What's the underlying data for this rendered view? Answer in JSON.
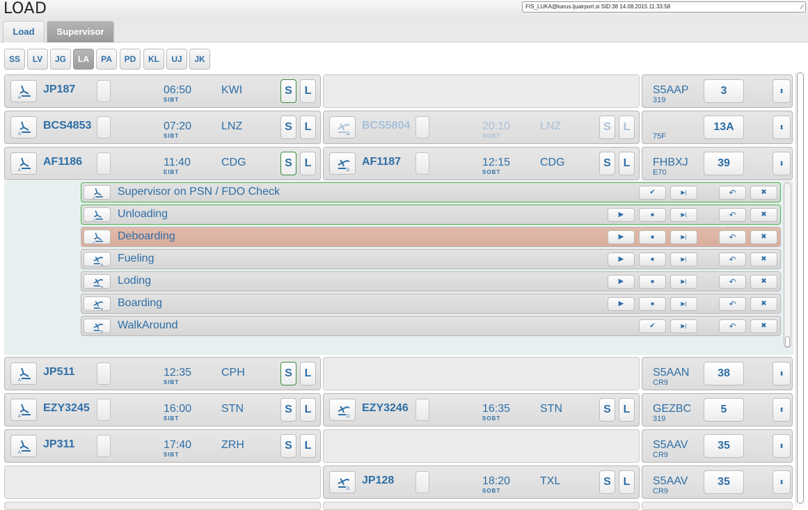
{
  "app": {
    "title": "LOAD",
    "session": "FIS_LUKA@karus.ljuairport.si SID:38 14.08.2015 11:33:58"
  },
  "tabs": [
    {
      "label": "Load",
      "active": false
    },
    {
      "label": "Supervisor",
      "active": true
    }
  ],
  "filters": [
    {
      "label": "SS",
      "active": false
    },
    {
      "label": "LV",
      "active": false
    },
    {
      "label": "JG",
      "active": false
    },
    {
      "label": "LA",
      "active": true
    },
    {
      "label": "PA",
      "active": false
    },
    {
      "label": "PD",
      "active": false
    },
    {
      "label": "KL",
      "active": false
    },
    {
      "label": "UJ",
      "active": false
    },
    {
      "label": "JK",
      "active": false
    }
  ],
  "s_label": "S",
  "l_label": "L",
  "rows": [
    {
      "arr": {
        "flight": "JP187",
        "time": "06:50",
        "time_label": "SIBT",
        "dest": "KWI",
        "s_green": true
      },
      "dep": null,
      "ac": {
        "reg": "S5AAP",
        "type": "319",
        "stand": "3"
      }
    },
    {
      "arr": {
        "flight": "BCS4853",
        "time": "07:20",
        "time_label": "SIBT",
        "dest": "LNZ",
        "s_green": false
      },
      "dep": {
        "flight": "BCS5804",
        "time": "20:10",
        "time_label": "SOBT",
        "dest": "LNZ",
        "faded": true
      },
      "ac": {
        "reg": "",
        "type": "75F",
        "stand": "13A"
      }
    },
    {
      "arr": {
        "flight": "AF1186",
        "time": "11:40",
        "time_label": "EIBT",
        "dest": "CDG",
        "s_green": true
      },
      "dep": {
        "flight": "AF1187",
        "time": "12:15",
        "time_label": "SOBT",
        "dest": "CDG",
        "faded": false
      },
      "ac": {
        "reg": "FHBXJ",
        "type": "E70",
        "stand": "39"
      }
    },
    {
      "arr": {
        "flight": "JP511",
        "time": "12:35",
        "time_label": "SIBT",
        "dest": "CPH",
        "s_green": true
      },
      "dep": null,
      "ac": {
        "reg": "S5AAN",
        "type": "CR9",
        "stand": "38"
      }
    },
    {
      "arr": {
        "flight": "EZY3245",
        "time": "16:00",
        "time_label": "SIBT",
        "dest": "STN",
        "s_green": false
      },
      "dep": {
        "flight": "EZY3246",
        "time": "16:35",
        "time_label": "SOBT",
        "dest": "STN",
        "faded": false
      },
      "ac": {
        "reg": "GEZBC",
        "type": "319",
        "stand": "5"
      }
    },
    {
      "arr": {
        "flight": "JP311",
        "time": "17:40",
        "time_label": "SIBT",
        "dest": "ZRH",
        "s_green": false
      },
      "dep": null,
      "ac": {
        "reg": "S5AAV",
        "type": "CR9",
        "stand": "35"
      }
    },
    {
      "arr": null,
      "dep": {
        "flight": "JP128",
        "time": "18:20",
        "time_label": "SOBT",
        "dest": "TXL",
        "faded": false
      },
      "ac": {
        "reg": "S5AAV",
        "type": "CR9",
        "stand": "35"
      }
    }
  ],
  "tasks": [
    {
      "name": "Supervisor on PSN / FDO Check",
      "kind": "arr",
      "state": "green",
      "mode": "check"
    },
    {
      "name": "Unloading",
      "kind": "arr",
      "state": "green",
      "mode": "play"
    },
    {
      "name": "Deboarding",
      "kind": "arr",
      "state": "salmon",
      "mode": "play"
    },
    {
      "name": "Fueling",
      "kind": "dep",
      "state": "normal",
      "mode": "play"
    },
    {
      "name": "Loding",
      "kind": "dep",
      "state": "normal",
      "mode": "play"
    },
    {
      "name": "Boarding",
      "kind": "dep",
      "state": "normal",
      "mode": "play"
    },
    {
      "name": "WalkAround",
      "kind": "dep",
      "state": "normal",
      "mode": "check"
    }
  ],
  "glyphs": {
    "play": "▶",
    "stop": "■",
    "skip": "▶|",
    "check": "✔",
    "undo": "↶",
    "cancel": "✖",
    "spin": "⬍",
    "grip": "⁄⁄"
  },
  "icons": {
    "arr": "plane-arrival-icon",
    "dep": "plane-departure-icon"
  },
  "colors": {
    "accent": "#2e6ea6",
    "green_border": "#49b849",
    "salmon": "#e3bbab",
    "panel": "#e8eff1"
  }
}
